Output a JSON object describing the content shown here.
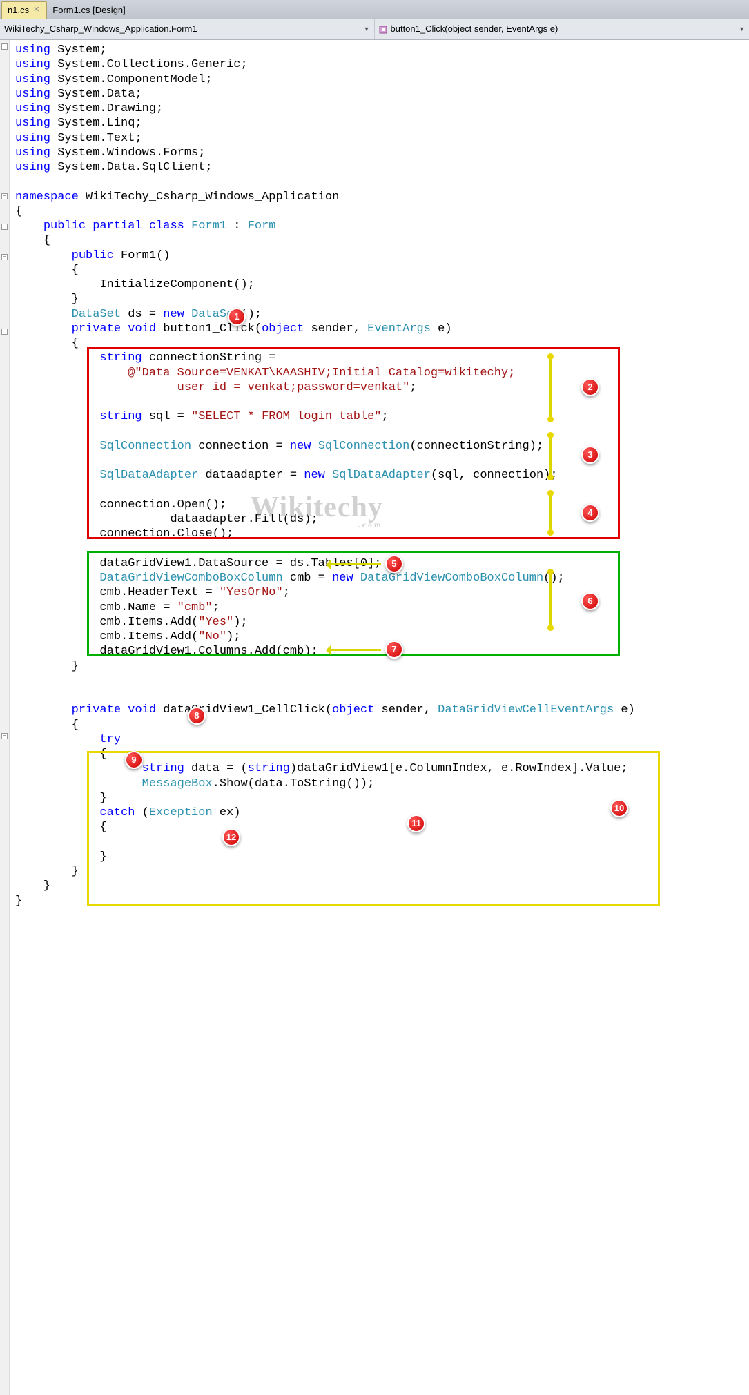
{
  "tabs": [
    {
      "label": "n1.cs",
      "active": true
    },
    {
      "label": "Form1.cs [Design]",
      "active": false
    }
  ],
  "nav": {
    "left": "WikiTechy_Csharp_Windows_Application.Form1",
    "right": "button1_Click(object sender, EventArgs e)"
  },
  "annotations": {
    "1": "1",
    "2": "2",
    "3": "3",
    "4": "4",
    "5": "5",
    "6": "6",
    "7": "7",
    "8": "8",
    "9": "9",
    "10": "10",
    "11": "11",
    "12": "12"
  },
  "watermark": {
    "main": "Wikitechy",
    "sub": ".com"
  },
  "code": {
    "usings": [
      "System",
      "System.Collections.Generic",
      "System.ComponentModel",
      "System.Data",
      "System.Drawing",
      "System.Linq",
      "System.Text",
      "System.Windows.Forms",
      "System.Data.SqlClient"
    ],
    "namespace": "WikiTechy_Csharp_Windows_Application",
    "class": "Form1",
    "base": "Form",
    "ctor": "Form1",
    "init": "InitializeComponent();",
    "dataset_decl_a": "DataSet",
    "dataset_decl_b": " ds = ",
    "dataset_decl_c": "new",
    "dataset_decl_d": "DataSet",
    "dataset_decl_e": "();",
    "m1_sig_a": "private void",
    "m1_sig_b": " button1_Click(",
    "m1_sig_c": "object",
    "m1_sig_d": " sender, ",
    "m1_sig_e": "EventArgs",
    "m1_sig_f": " e)",
    "connStr1": "string",
    "connStr2": " connectionString =",
    "connStr3": "@\"Data Source=VENKAT\\KAASHIV;Initial Catalog=wikitechy;",
    "connStr4": "user id = venkat;password=venkat\"",
    "sql1": "string",
    "sql2": " sql = ",
    "sql3": "\"SELECT * FROM login_table\"",
    "sqlconn1": "SqlConnection",
    "sqlconn2": " connection = ",
    "sqlconn3": "new",
    "sqlconn4": "SqlConnection",
    "sqlconn5": "(connectionString);",
    "adapter1": "SqlDataAdapter",
    "adapter2": " dataadapter = ",
    "adapter3": "new",
    "adapter4": "SqlDataAdapter",
    "adapter5": "(sql, connection);",
    "open": "connection.Open();",
    "fill": "dataadapter.Fill(ds);",
    "close": "connection.Close();",
    "dgv_src": "dataGridView1.DataSource = ds.Tables[0];",
    "cmb1": "DataGridViewComboBoxColumn",
    "cmb2": " cmb = ",
    "cmb3": "new",
    "cmb4": "DataGridViewComboBoxColumn",
    "cmb5": "();",
    "cmb_h1": "cmb.HeaderText = ",
    "cmb_h2": "\"YesOrNo\"",
    "cmb_n1": "cmb.Name = ",
    "cmb_n2": "\"cmb\"",
    "cmb_y1": "cmb.Items.Add(",
    "cmb_y2": "\"Yes\"",
    "cmb_y3": ");",
    "cmb_no1": "cmb.Items.Add(",
    "cmb_no2": "\"No\"",
    "cmb_no3": ");",
    "cmb_add": "dataGridView1.Columns.Add(cmb);",
    "m2_sig_a": "private void",
    "m2_sig_b": " dataGridView1_CellClick(",
    "m2_sig_c": "object",
    "m2_sig_d": " sender, ",
    "m2_sig_e": "DataGridViewCellEventArgs",
    "m2_sig_f": " e)",
    "try": "try",
    "dat1": "string",
    "dat2": " data = (",
    "dat3": "string",
    "dat4": ")dataGridView1[e.ColumnIndex, e.RowIndex].Value;",
    "mb1": "MessageBox",
    "mb2": ".Show(data.ToString());",
    "catch1": "catch",
    "catch2": " (",
    "catch3": "Exception",
    "catch4": " ex)"
  }
}
